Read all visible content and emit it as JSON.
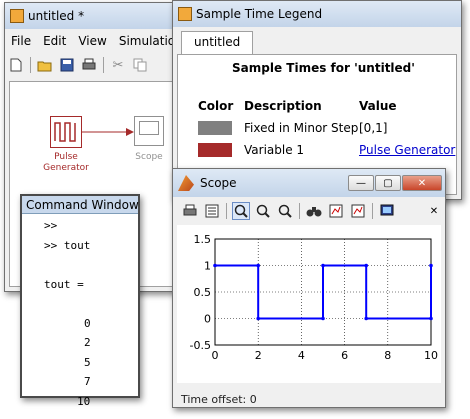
{
  "model_window": {
    "title": "untitled *",
    "menu": [
      "File",
      "Edit",
      "View",
      "Simulation"
    ],
    "blocks": {
      "pulse_label_line1": "Pulse",
      "pulse_label_line2": "Generator",
      "scope_label": "Scope"
    }
  },
  "legend_window": {
    "title": "Sample Time Legend",
    "tab": "untitled",
    "heading": "Sample Times for 'untitled'",
    "columns": [
      "Color",
      "Description",
      "Value"
    ],
    "rows": [
      {
        "color": "#808080",
        "description": "Fixed in Minor Step",
        "value": "[0,1]",
        "value_is_link": false
      },
      {
        "color": "#a52a2a",
        "description": "Variable 1",
        "value": "Pulse Generator",
        "value_is_link": true
      }
    ]
  },
  "command_window": {
    "title": "Command Window",
    "lines": [
      ">>",
      ">> tout",
      "",
      "tout =",
      "",
      "0",
      "2",
      "5",
      "7",
      "10"
    ]
  },
  "scope_window": {
    "title": "Scope",
    "status_text": "Time offset:  0"
  },
  "chart_data": {
    "type": "line",
    "title": "",
    "xlabel": "",
    "ylabel": "",
    "xlim": [
      0,
      10
    ],
    "ylim": [
      -0.5,
      1.5
    ],
    "x_ticks": [
      0,
      2,
      4,
      6,
      8,
      10
    ],
    "y_ticks": [
      -0.5,
      0,
      0.5,
      1,
      1.5
    ],
    "grid": true,
    "series": [
      {
        "line_color": "#0000ff",
        "x": [
          0,
          2,
          2,
          5,
          5,
          7,
          7,
          10,
          10
        ],
        "y": [
          1,
          1,
          0,
          0,
          1,
          1,
          0,
          0,
          1
        ],
        "marker_x": [
          0,
          2,
          5,
          7,
          10
        ],
        "marker_y": [
          1,
          1,
          0,
          1,
          0,
          1,
          0,
          1
        ]
      }
    ],
    "markers": [
      [
        0,
        1
      ],
      [
        2,
        1
      ],
      [
        2,
        0
      ],
      [
        5,
        0
      ],
      [
        5,
        1
      ],
      [
        7,
        1
      ],
      [
        7,
        0
      ],
      [
        10,
        0
      ],
      [
        10,
        1
      ]
    ]
  }
}
